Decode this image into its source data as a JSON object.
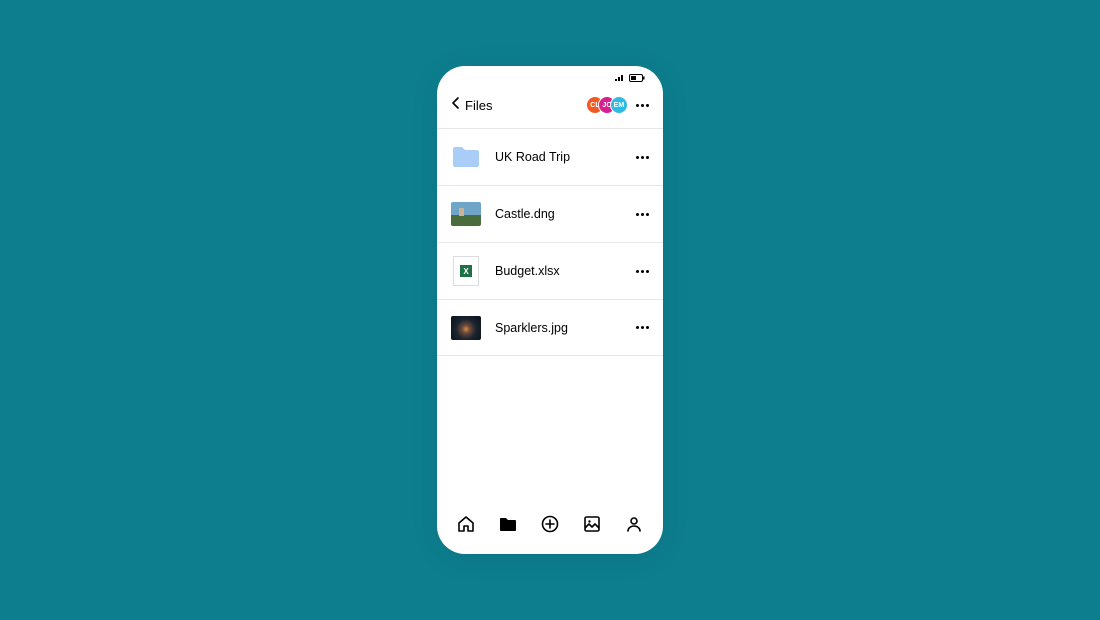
{
  "header": {
    "back_label": "Files"
  },
  "avatars": [
    {
      "initials": "CL",
      "color": "#f05a22"
    },
    {
      "initials": "JC",
      "color": "#d6208f"
    },
    {
      "initials": "EM",
      "color": "#2dbbe6"
    }
  ],
  "files": [
    {
      "name": "UK Road Trip",
      "type": "folder"
    },
    {
      "name": "Castle.dng",
      "type": "image-landscape"
    },
    {
      "name": "Budget.xlsx",
      "type": "excel"
    },
    {
      "name": "Sparklers.jpg",
      "type": "image-dark"
    }
  ],
  "nav": {
    "home": "home-icon",
    "files": "folder-icon",
    "add": "plus-circle-icon",
    "photos": "photo-icon",
    "account": "person-icon"
  }
}
